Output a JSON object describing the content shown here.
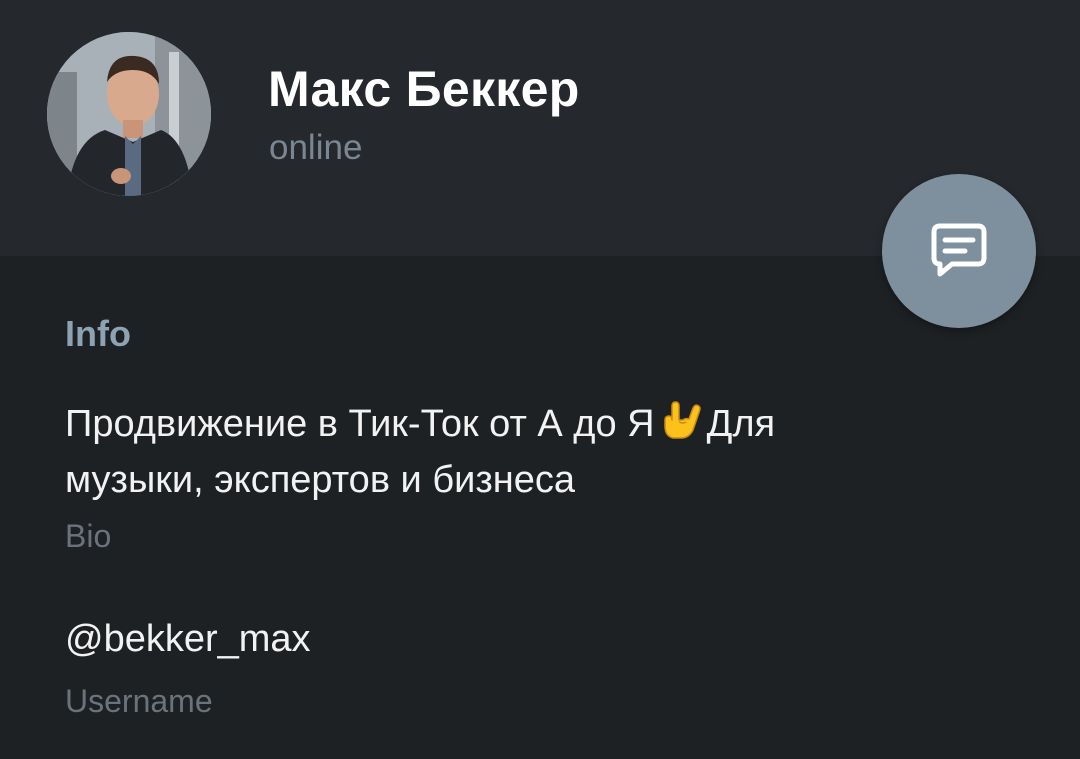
{
  "profile": {
    "name": "Макс Беккер",
    "status": "online",
    "avatar_icon": "user-avatar-photo"
  },
  "fab": {
    "icon": "message-icon"
  },
  "info": {
    "section_title": "Info",
    "bio_line1_before_emoji": "Продвижение в Тик-Ток от А до Я",
    "bio_emoji": "love-you-gesture-emoji",
    "bio_line1_after_emoji": "Для",
    "bio_line2": "музыки, экспертов и бизнеса",
    "bio_label": "Bio",
    "username": "@bekker_max",
    "username_label": "Username"
  },
  "colors": {
    "header_bg": "#25282c",
    "body_bg": "#1e2124",
    "accent": "#8da2b3",
    "fab_bg": "#7e8f9d"
  }
}
